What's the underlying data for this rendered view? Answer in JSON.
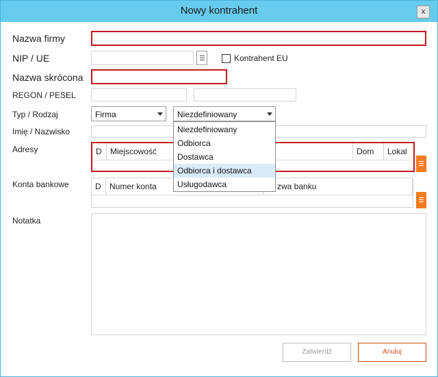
{
  "window": {
    "title": "Nowy kontrahent",
    "close_glyph": "x"
  },
  "form": {
    "company_name": {
      "label": "Nazwa firmy",
      "value": ""
    },
    "nip": {
      "label": "NIP / UE",
      "value": ""
    },
    "eu_contractor": {
      "label": "Kontrahent EU",
      "checked": false
    },
    "short_name": {
      "label": "Nazwa skrócona",
      "value": ""
    },
    "regon": {
      "label": "REGON / PESEL",
      "value": ""
    },
    "type": {
      "label": "Typ / Rodzaj",
      "selected": "Firma"
    },
    "kind": {
      "selected": "Niezdefiniowany",
      "options": [
        "Niezdefiniowany",
        "Odbiorca",
        "Dostawca",
        "Odbiorca i dostawca",
        "Usługodawca"
      ],
      "highlighted": "Odbiorca i dostawca"
    },
    "name": {
      "label": "Imię / Nazwisko",
      "value": ""
    },
    "addresses": {
      "label": "Adresy",
      "columns": [
        "D",
        "Miejscowość",
        "Dom",
        "Lokal"
      ]
    },
    "bank_accounts": {
      "label": "Konta bankowe",
      "columns": [
        "D",
        "Numer konta",
        "Nazwa banku"
      ],
      "visible_bank_column": "zwa banku"
    },
    "notes": {
      "label": "Notatka",
      "value": ""
    }
  },
  "buttons": {
    "confirm": "Zatwierdź",
    "cancel": "Anuluj"
  },
  "colors": {
    "titlebar": "#66cbec",
    "required_border": "#c4161c",
    "accent_orange": "#f47c20",
    "selected_item": "#d9ebf9"
  },
  "icons": {
    "list": "list-icon",
    "close": "close-icon"
  }
}
